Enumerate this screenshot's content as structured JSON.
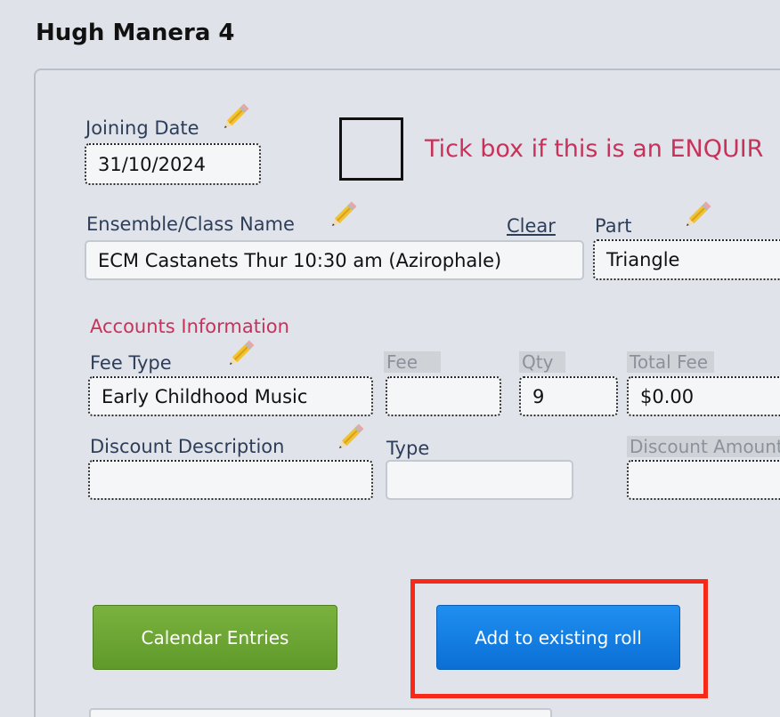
{
  "record": {
    "title": "Hugh Manera 4"
  },
  "joining": {
    "label": "Joining Date",
    "value": "31/10/2024"
  },
  "enquiry": {
    "text": "Tick box if this is an ENQUIR"
  },
  "ensemble": {
    "label": "Ensemble/Class Name",
    "clear_label": "Clear",
    "value": "ECM Castanets Thur 10:30 am (Azirophale)"
  },
  "part": {
    "label": "Part",
    "value": "Triangle"
  },
  "accounts": {
    "heading": "Accounts Information",
    "fee_type_label": "Fee Type",
    "fee_type_value": "Early Childhood Music",
    "fee_label": "Fee",
    "fee_value": "",
    "qty_label": "Qty",
    "qty_value": "9",
    "total_fee_label": "Total Fee",
    "total_fee_value": "$0.00",
    "discount_description_label": "Discount Description",
    "discount_description_value": "",
    "type_label": "Type",
    "type_value": "",
    "discount_amount_label": "Discount Amount",
    "discount_amount_value": ""
  },
  "buttons": {
    "calendar_entries": "Calendar Entries",
    "add_to_roll": "Add to existing roll"
  },
  "colors": {
    "accent_red": "#c8325a",
    "green_button": "#6aa533",
    "blue_button": "#1580e4",
    "highlight": "#f52a18"
  }
}
